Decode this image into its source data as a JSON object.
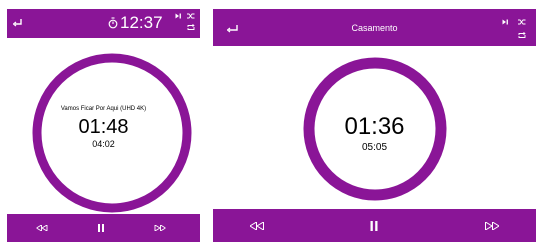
{
  "colors": {
    "bar": "#8a1597",
    "ring_track": "#8a1597",
    "ring_progress": "#38f23a",
    "text": "#000000"
  },
  "left": {
    "header": {
      "time": "12:37",
      "icons": [
        "back-arrow-icon",
        "timer-icon",
        "skip-next-icon",
        "shuffle-icon",
        "repeat-icon"
      ]
    },
    "timer": {
      "track_title": "Vamos Ficar Por Aqui (UHD 4K)",
      "elapsed": "01:48",
      "total": "04:02",
      "progress": 0.446
    },
    "controls": [
      "rewind-icon",
      "pause-icon",
      "fast-forward-icon"
    ]
  },
  "right": {
    "header": {
      "title": "Casamento",
      "icons": [
        "back-arrow-icon",
        "skip-next-icon",
        "shuffle-icon",
        "repeat-icon"
      ]
    },
    "timer": {
      "elapsed": "01:36",
      "total": "05:05",
      "progress": 0.315
    },
    "controls": [
      "rewind-icon",
      "pause-icon",
      "fast-forward-icon"
    ]
  }
}
